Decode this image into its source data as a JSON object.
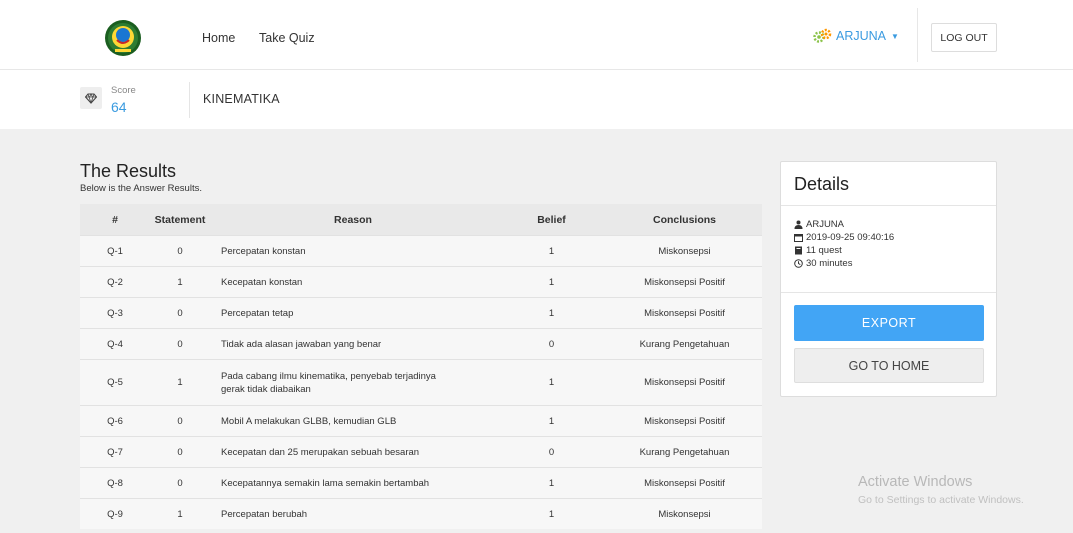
{
  "navbar": {
    "links": {
      "home": "Home",
      "take_quiz": "Take Quiz"
    },
    "user": {
      "name": "ARJUNA",
      "icon": "gear-icon"
    },
    "logout_label": "LOG OUT"
  },
  "score_bar": {
    "label": "Score",
    "value": "64",
    "topic": "KINEMATIKA",
    "icon": "diamond-icon"
  },
  "results": {
    "title": "The Results",
    "subtitle": "Below is the Answer Results.",
    "columns": [
      "#",
      "Statement",
      "Reason",
      "Belief",
      "Conclusions"
    ],
    "rows": [
      {
        "num": "Q-1",
        "statement": "0",
        "reason": "Percepatan konstan",
        "belief": "1",
        "conclusion": "Miskonsepsi"
      },
      {
        "num": "Q-2",
        "statement": "1",
        "reason": "Kecepatan konstan",
        "belief": "1",
        "conclusion": "Miskonsepsi Positif"
      },
      {
        "num": "Q-3",
        "statement": "0",
        "reason": "Percepatan tetap",
        "belief": "1",
        "conclusion": "Miskonsepsi Positif"
      },
      {
        "num": "Q-4",
        "statement": "0",
        "reason": "Tidak ada alasan jawaban yang benar",
        "belief": "0",
        "conclusion": "Kurang Pengetahuan"
      },
      {
        "num": "Q-5",
        "statement": "1",
        "reason": "Pada cabang ilmu kinematika, penyebab terjadinya gerak tidak diabaikan",
        "belief": "1",
        "conclusion": "Miskonsepsi Positif"
      },
      {
        "num": "Q-6",
        "statement": "0",
        "reason": "Mobil A melakukan GLBB, kemudian GLB",
        "belief": "1",
        "conclusion": "Miskonsepsi Positif"
      },
      {
        "num": "Q-7",
        "statement": "0",
        "reason": "Kecepatan dan 25 merupakan sebuah besaran",
        "belief": "0",
        "conclusion": "Kurang Pengetahuan"
      },
      {
        "num": "Q-8",
        "statement": "0",
        "reason": "Kecepatannya semakin lama semakin bertambah",
        "belief": "1",
        "conclusion": "Miskonsepsi Positif"
      },
      {
        "num": "Q-9",
        "statement": "1",
        "reason": "Percepatan berubah",
        "belief": "1",
        "conclusion": "Miskonsepsi"
      }
    ]
  },
  "details": {
    "title": "Details",
    "user": "ARJUNA",
    "datetime": "2019-09-25 09:40:16",
    "quest": "11 quest",
    "duration": "30 minutes",
    "export_label": "EXPORT",
    "home_label": "GO TO HOME"
  },
  "watermark": {
    "title": "Activate Windows",
    "subtitle": "Go to Settings to activate Windows."
  },
  "colors": {
    "accent": "#42a5f5",
    "link_blue": "#3a9be0",
    "background_gray": "#f0f0f0"
  }
}
